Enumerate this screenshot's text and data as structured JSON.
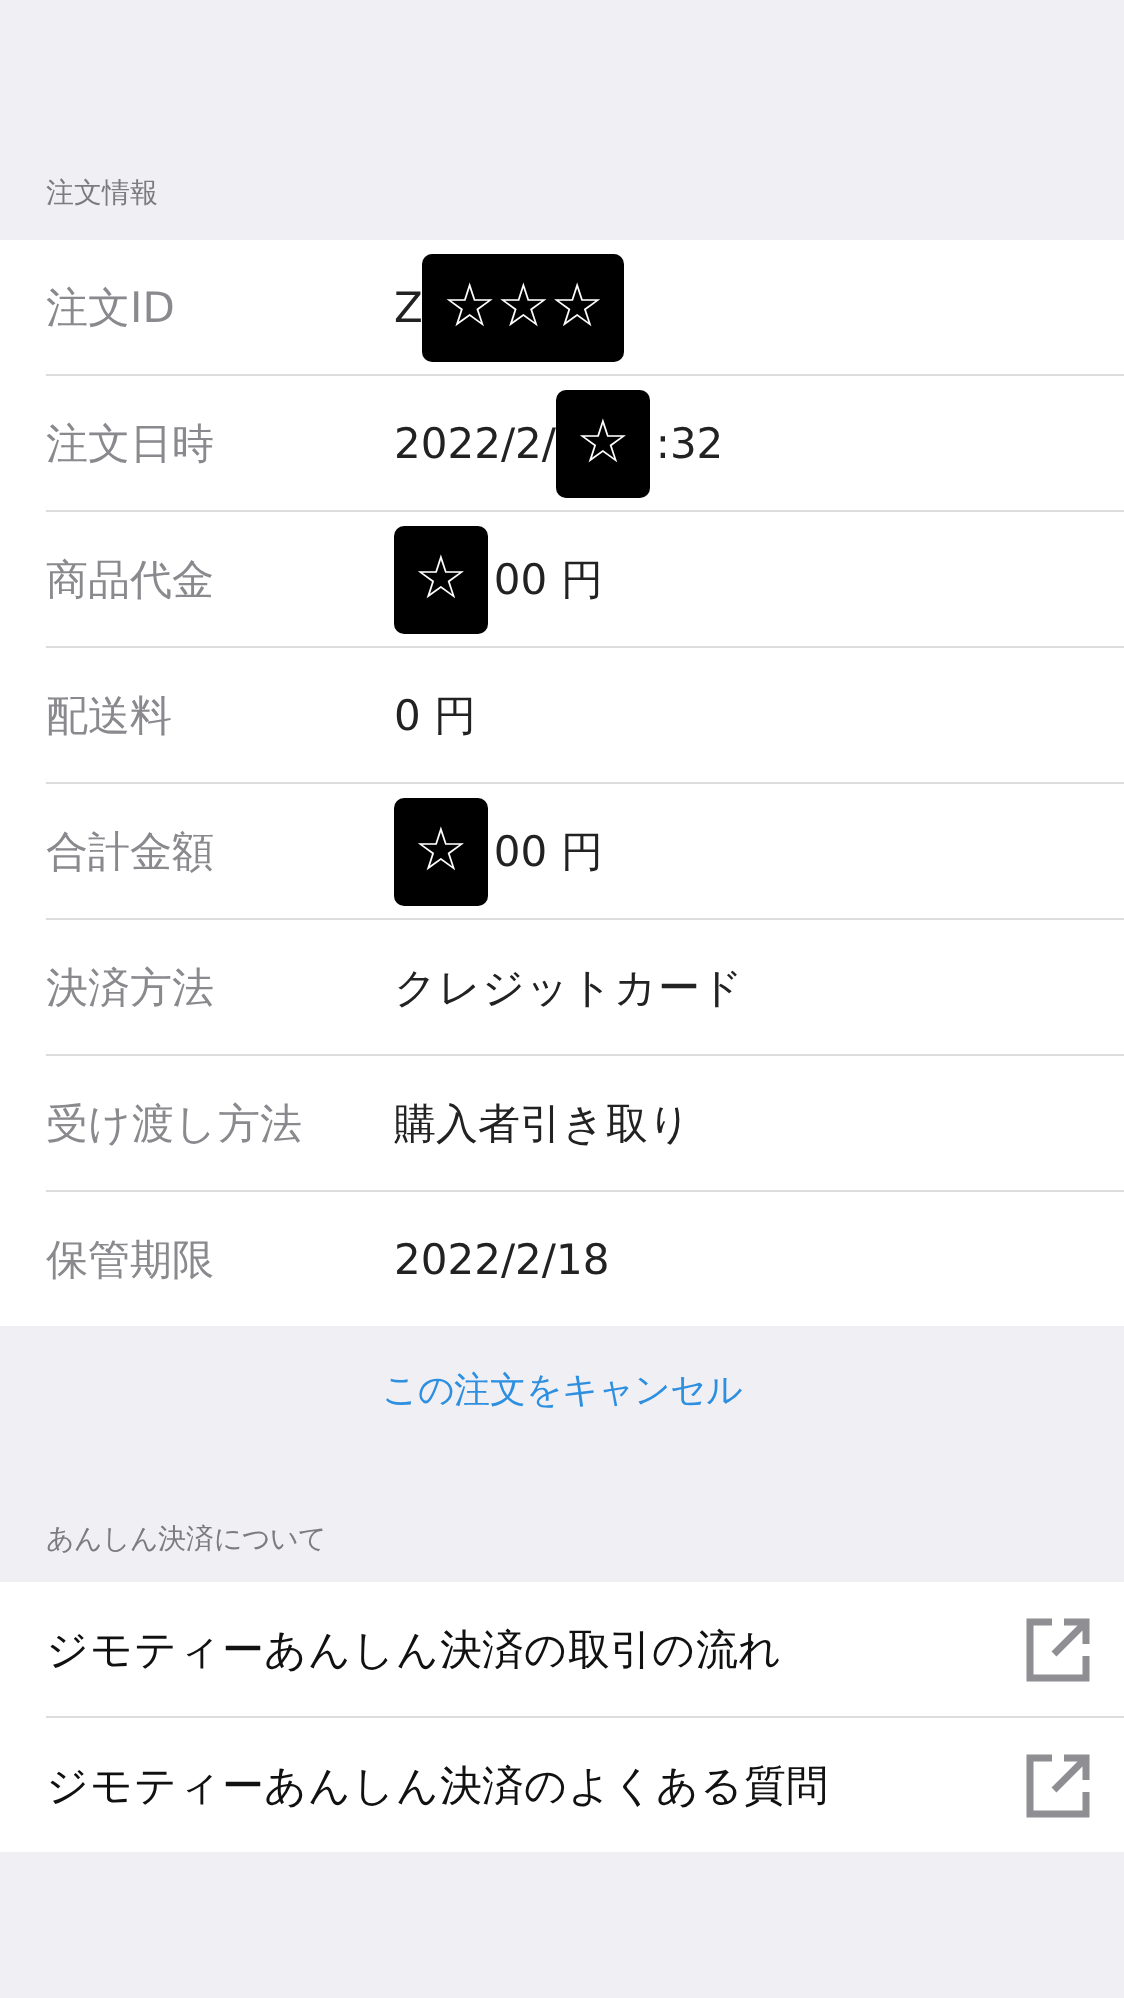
{
  "order_section": {
    "header": "注文情報",
    "rows": [
      {
        "label": "注文ID",
        "value": [
          {
            "kind": "text",
            "text": "Z"
          },
          {
            "kind": "redaction",
            "text": "☆☆☆"
          }
        ]
      },
      {
        "label": "注文日時",
        "value": [
          {
            "kind": "text",
            "text": "2022/2/"
          },
          {
            "kind": "redaction",
            "text": "☆"
          },
          {
            "kind": "text",
            "text": ":32"
          }
        ]
      },
      {
        "label": "商品代金",
        "value": [
          {
            "kind": "redaction",
            "text": "☆"
          },
          {
            "kind": "text",
            "text": "00 円"
          }
        ]
      },
      {
        "label": "配送料",
        "value": [
          {
            "kind": "text",
            "text": "0 円"
          }
        ]
      },
      {
        "label": "合計金額",
        "value": [
          {
            "kind": "redaction",
            "text": "☆"
          },
          {
            "kind": "text",
            "text": "00 円"
          }
        ]
      },
      {
        "label": "決済方法",
        "value": [
          {
            "kind": "text",
            "text": "クレジットカード"
          }
        ]
      },
      {
        "label": "受け渡し方法",
        "value": [
          {
            "kind": "text",
            "text": "購入者引き取り"
          }
        ]
      },
      {
        "label": "保管期限",
        "value": [
          {
            "kind": "text",
            "text": "2022/2/18"
          }
        ]
      }
    ]
  },
  "cancel_link": "この注文をキャンセル",
  "info_section": {
    "header": "あんしん決済について",
    "links": [
      {
        "label": "ジモティーあんしん決済の取引の流れ"
      },
      {
        "label": "ジモティーあんしん決済のよくある質問"
      }
    ]
  }
}
